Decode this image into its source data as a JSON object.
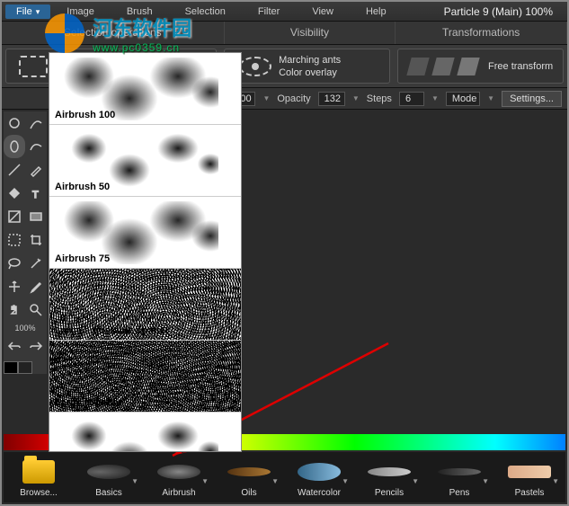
{
  "menu": {
    "file": "File",
    "image": "Image",
    "brush": "Brush",
    "selection": "Selection",
    "filter": "Filter",
    "view": "View",
    "help": "Help"
  },
  "title": "Particle 9  (Main)   100%",
  "subheader": {
    "sel_ops": "Selection operations",
    "visibility": "Visibility",
    "transformations": "Transformations"
  },
  "visibility": {
    "marching": "Marching ants",
    "overlay": "Color overlay"
  },
  "transform": {
    "free": "Free transform"
  },
  "options": {
    "size_val": "100",
    "opacity_lbl": "Opacity",
    "opacity_val": "132",
    "steps_lbl": "Steps",
    "steps_val": "6",
    "mode_lbl": "Mode",
    "settings": "Settings..."
  },
  "toolbar": {
    "pct": "100%"
  },
  "brush_popup": {
    "items": [
      {
        "label": "Airbrush 100"
      },
      {
        "label": "Airbrush 50"
      },
      {
        "label": "Airbrush 75"
      },
      {
        "label": "Large adjustable spatter"
      },
      {
        "label": "Larger Spatter"
      },
      {
        "label": ""
      }
    ]
  },
  "brush_categories": [
    {
      "label": "Browse..."
    },
    {
      "label": "Basics"
    },
    {
      "label": "Airbrush"
    },
    {
      "label": "Oils"
    },
    {
      "label": "Watercolor"
    },
    {
      "label": "Pencils"
    },
    {
      "label": "Pens"
    },
    {
      "label": "Pastels"
    }
  ],
  "watermark": {
    "cn": "河东软件园",
    "url": "www.pc0359.cn"
  }
}
